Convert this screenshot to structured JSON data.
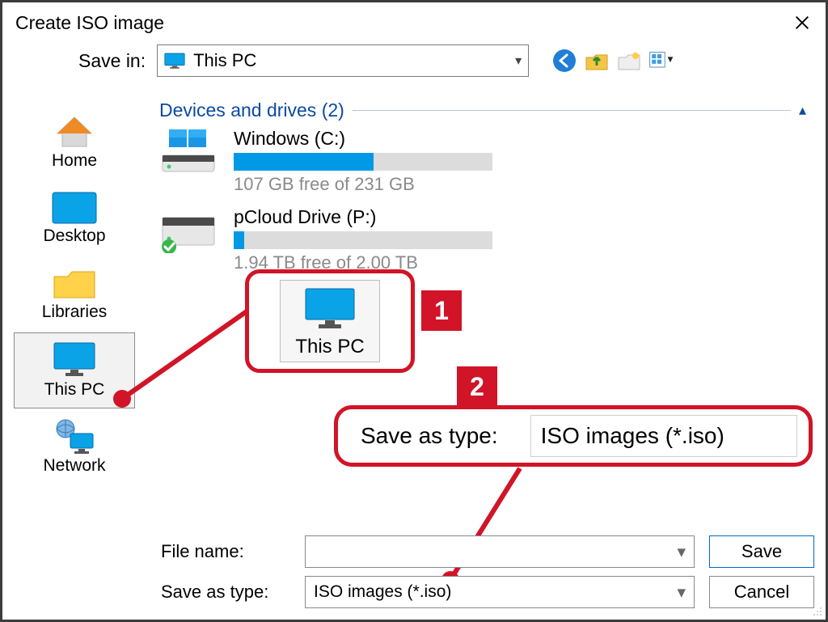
{
  "window": {
    "title": "Create ISO image"
  },
  "save_in": {
    "label": "Save in:",
    "value": "This PC"
  },
  "toolbar_icons": {
    "back": "back-icon",
    "up": "up-folder-icon",
    "new": "new-folder-icon",
    "view": "view-menu-icon"
  },
  "sidebar": {
    "items": [
      {
        "label": "Home",
        "icon": "home-icon"
      },
      {
        "label": "Desktop",
        "icon": "desktop-icon"
      },
      {
        "label": "Libraries",
        "icon": "folder-icon"
      },
      {
        "label": "This PC",
        "icon": "pc-icon",
        "selected": true
      },
      {
        "label": "Network",
        "icon": "network-icon"
      }
    ]
  },
  "main": {
    "group_label": "Devices and drives (2)",
    "drives": [
      {
        "name": "Windows (C:)",
        "free_text": "107 GB free of 231 GB",
        "fill_pct": 54
      },
      {
        "name": "pCloud Drive (P:)",
        "free_text": "1.94 TB free of 2.00 TB",
        "fill_pct": 4
      }
    ]
  },
  "annotations": {
    "callout1": {
      "label": "This PC",
      "badge": "1"
    },
    "callout2": {
      "label": "Save as type:",
      "value": "ISO images (*.iso)",
      "badge": "2"
    }
  },
  "bottom": {
    "filename_label": "File name:",
    "filename_value": "",
    "savetype_label": "Save as type:",
    "savetype_value": "ISO images (*.iso)",
    "save_btn": "Save",
    "cancel_btn": "Cancel"
  }
}
